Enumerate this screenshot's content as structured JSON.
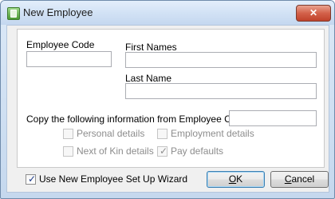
{
  "window": {
    "title": "New Employee",
    "close_glyph": "✕"
  },
  "form": {
    "employee_code_label": "Employee Code",
    "employee_code_value": "",
    "first_names_label": "First Names",
    "first_names_value": "",
    "last_name_label": "Last Name",
    "last_name_value": "",
    "copy_label": "Copy the following information from Employee Code:",
    "copy_code_value": ""
  },
  "copy_options": [
    {
      "label": "Personal details",
      "checked": false,
      "enabled": false
    },
    {
      "label": "Employment details",
      "checked": false,
      "enabled": false
    },
    {
      "label": "Next of Kin details",
      "checked": false,
      "enabled": false
    },
    {
      "label": "Pay defaults",
      "checked": true,
      "enabled": false
    }
  ],
  "wizard": {
    "label": "Use New Employee Set Up Wizard",
    "checked": true
  },
  "buttons": {
    "ok_access": "O",
    "ok_rest": "K",
    "cancel_access": "C",
    "cancel_rest": "ancel"
  }
}
